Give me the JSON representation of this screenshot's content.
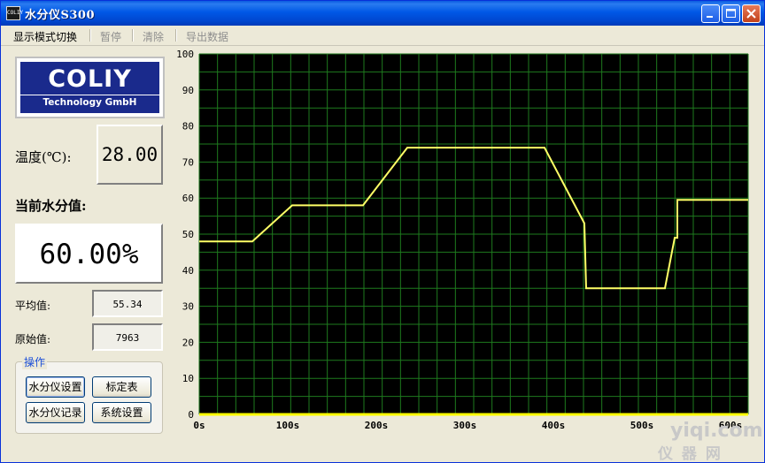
{
  "window": {
    "title": "水分仪S300",
    "icon": "app-logo-icon"
  },
  "menu": {
    "items": [
      "显示模式切换",
      "暂停",
      "清除",
      "导出数据"
    ]
  },
  "logo": {
    "main": "COLIY",
    "sub": "Technology GmbH"
  },
  "temperature": {
    "label": "温度(℃):",
    "value": "28.00"
  },
  "moisture": {
    "label": "当前水分值:",
    "value": "60.00%"
  },
  "average": {
    "label": "平均值:",
    "value": "55.34"
  },
  "raw": {
    "label": "原始值:",
    "value": "7963"
  },
  "operations": {
    "title": "操作",
    "buttons": [
      "水分仪设置",
      "标定表",
      "水分仪记录",
      "系统设置"
    ]
  },
  "watermark": {
    "main": "yiqi.com",
    "sub": "仪 器 网"
  },
  "colors": {
    "plot_bg": "#000000",
    "grid": "#1e7a1e",
    "line": "#ffff66",
    "baseline": "#ffff00"
  },
  "chart_data": {
    "type": "line",
    "title": "",
    "xlabel": "",
    "ylabel": "",
    "xlim": [
      0,
      620
    ],
    "ylim": [
      0,
      100
    ],
    "grid": true,
    "yticks": [
      "0",
      "10",
      "20",
      "30",
      "40",
      "50",
      "60",
      "70",
      "80",
      "90",
      "100"
    ],
    "xticks": [
      {
        "v": 0,
        "label": "0s"
      },
      {
        "v": 100,
        "label": "100s"
      },
      {
        "v": 200,
        "label": "200s"
      },
      {
        "v": 300,
        "label": "300s"
      },
      {
        "v": 400,
        "label": "400s"
      },
      {
        "v": 500,
        "label": "500s"
      },
      {
        "v": 600,
        "label": "600s"
      }
    ],
    "series": [
      {
        "values": [
          [
            0,
            48
          ],
          [
            60,
            48
          ],
          [
            105,
            58
          ],
          [
            185,
            58
          ],
          [
            235,
            74
          ],
          [
            390,
            74
          ],
          [
            435,
            53
          ],
          [
            437,
            35
          ],
          [
            526,
            35
          ],
          [
            537,
            49
          ],
          [
            540,
            49
          ],
          [
            540,
            59.5
          ],
          [
            620,
            59.5
          ]
        ]
      }
    ]
  }
}
